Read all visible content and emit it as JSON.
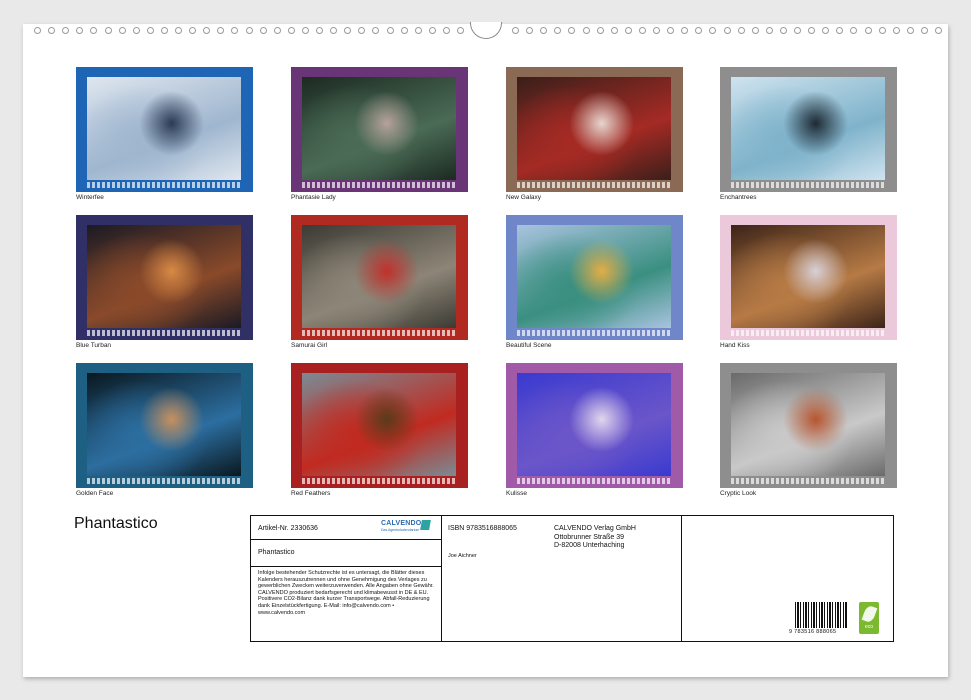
{
  "calendar": {
    "title": "Phantastico",
    "thumbnails": [
      {
        "caption": "Winterfee",
        "frame": "#1f65b5",
        "photo": [
          "#dfe6ef",
          "#9fb6cf",
          "#2b3a55"
        ]
      },
      {
        "caption": "Phantasie Lady",
        "frame": "#6a3576",
        "photo": [
          "#1c2a22",
          "#4a6b55",
          "#b5a29b"
        ]
      },
      {
        "caption": "New Galaxy",
        "frame": "#8a6a55",
        "photo": [
          "#3a1f1a",
          "#a52a24",
          "#e7d6cf"
        ]
      },
      {
        "caption": "Enchantrees",
        "frame": "#8e8e8e",
        "photo": [
          "#cfe3ef",
          "#7fb3cb",
          "#1e2a34"
        ]
      },
      {
        "caption": "Blue Turban",
        "frame": "#302f66",
        "photo": [
          "#1a1a24",
          "#8a4a2a",
          "#d88a45"
        ]
      },
      {
        "caption": "Samurai Girl",
        "frame": "#b02a22",
        "photo": [
          "#3b3a33",
          "#8d8577",
          "#c1312c"
        ]
      },
      {
        "caption": "Beautiful Scene",
        "frame": "#6f86c9",
        "photo": [
          "#a9c3df",
          "#3a8f80",
          "#e2ad45"
        ]
      },
      {
        "caption": "Hand Kiss",
        "frame": "#ecc8db",
        "photo": [
          "#3d2418",
          "#b67a45",
          "#d8d0d6"
        ]
      },
      {
        "caption": "Golden Face",
        "frame": "#1e5f84",
        "photo": [
          "#0a1820",
          "#2c6ea0",
          "#c7905f"
        ]
      },
      {
        "caption": "Red Feathers",
        "frame": "#a82020",
        "photo": [
          "#7a8b95",
          "#c12a20",
          "#5a3a1a"
        ]
      },
      {
        "caption": "Kulisse",
        "frame": "#a05aa8",
        "photo": [
          "#3a3ad0",
          "#6b56c9",
          "#e2d6ee"
        ]
      },
      {
        "caption": "Cryptic Look",
        "frame": "#8e8e8e",
        "photo": [
          "#6a6a6a",
          "#c9c9c9",
          "#b7562f"
        ]
      }
    ]
  },
  "info": {
    "article": "Artikel-Nr. 2330636",
    "brand": "CALVENDO",
    "brand_tagline": "Das Agenturkalendarium",
    "title": "Phantastico",
    "legal": "Infolge bestehender Schutzrechte ist es untersagt, die Blätter dieses Kalenders herauszutrennen und ohne Genehmigung des Verlages zu gewerblichen Zwecken weiterzuverwenden. Alle Angaben ohne Gewähr. CALVENDO produziert bedarfsgerecht und klimabewusst in DE & EU. Positivere CO2-Bilanz dank kurzer Transportwege. Abfall-Reduzierung dank Einzelstückfertigung. E-Mail: info@calvendo.com • www.calvendo.com",
    "isbn": "ISBN 9783516888065",
    "author": "Joe Aichner",
    "publisher_name": "CALVENDO Verlag GmbH",
    "publisher_street": "Ottobrunner Straße 39",
    "publisher_city": "D-82008 Unterhaching",
    "barcode_digits": "9 783516 888065",
    "eco_label": "eco"
  }
}
